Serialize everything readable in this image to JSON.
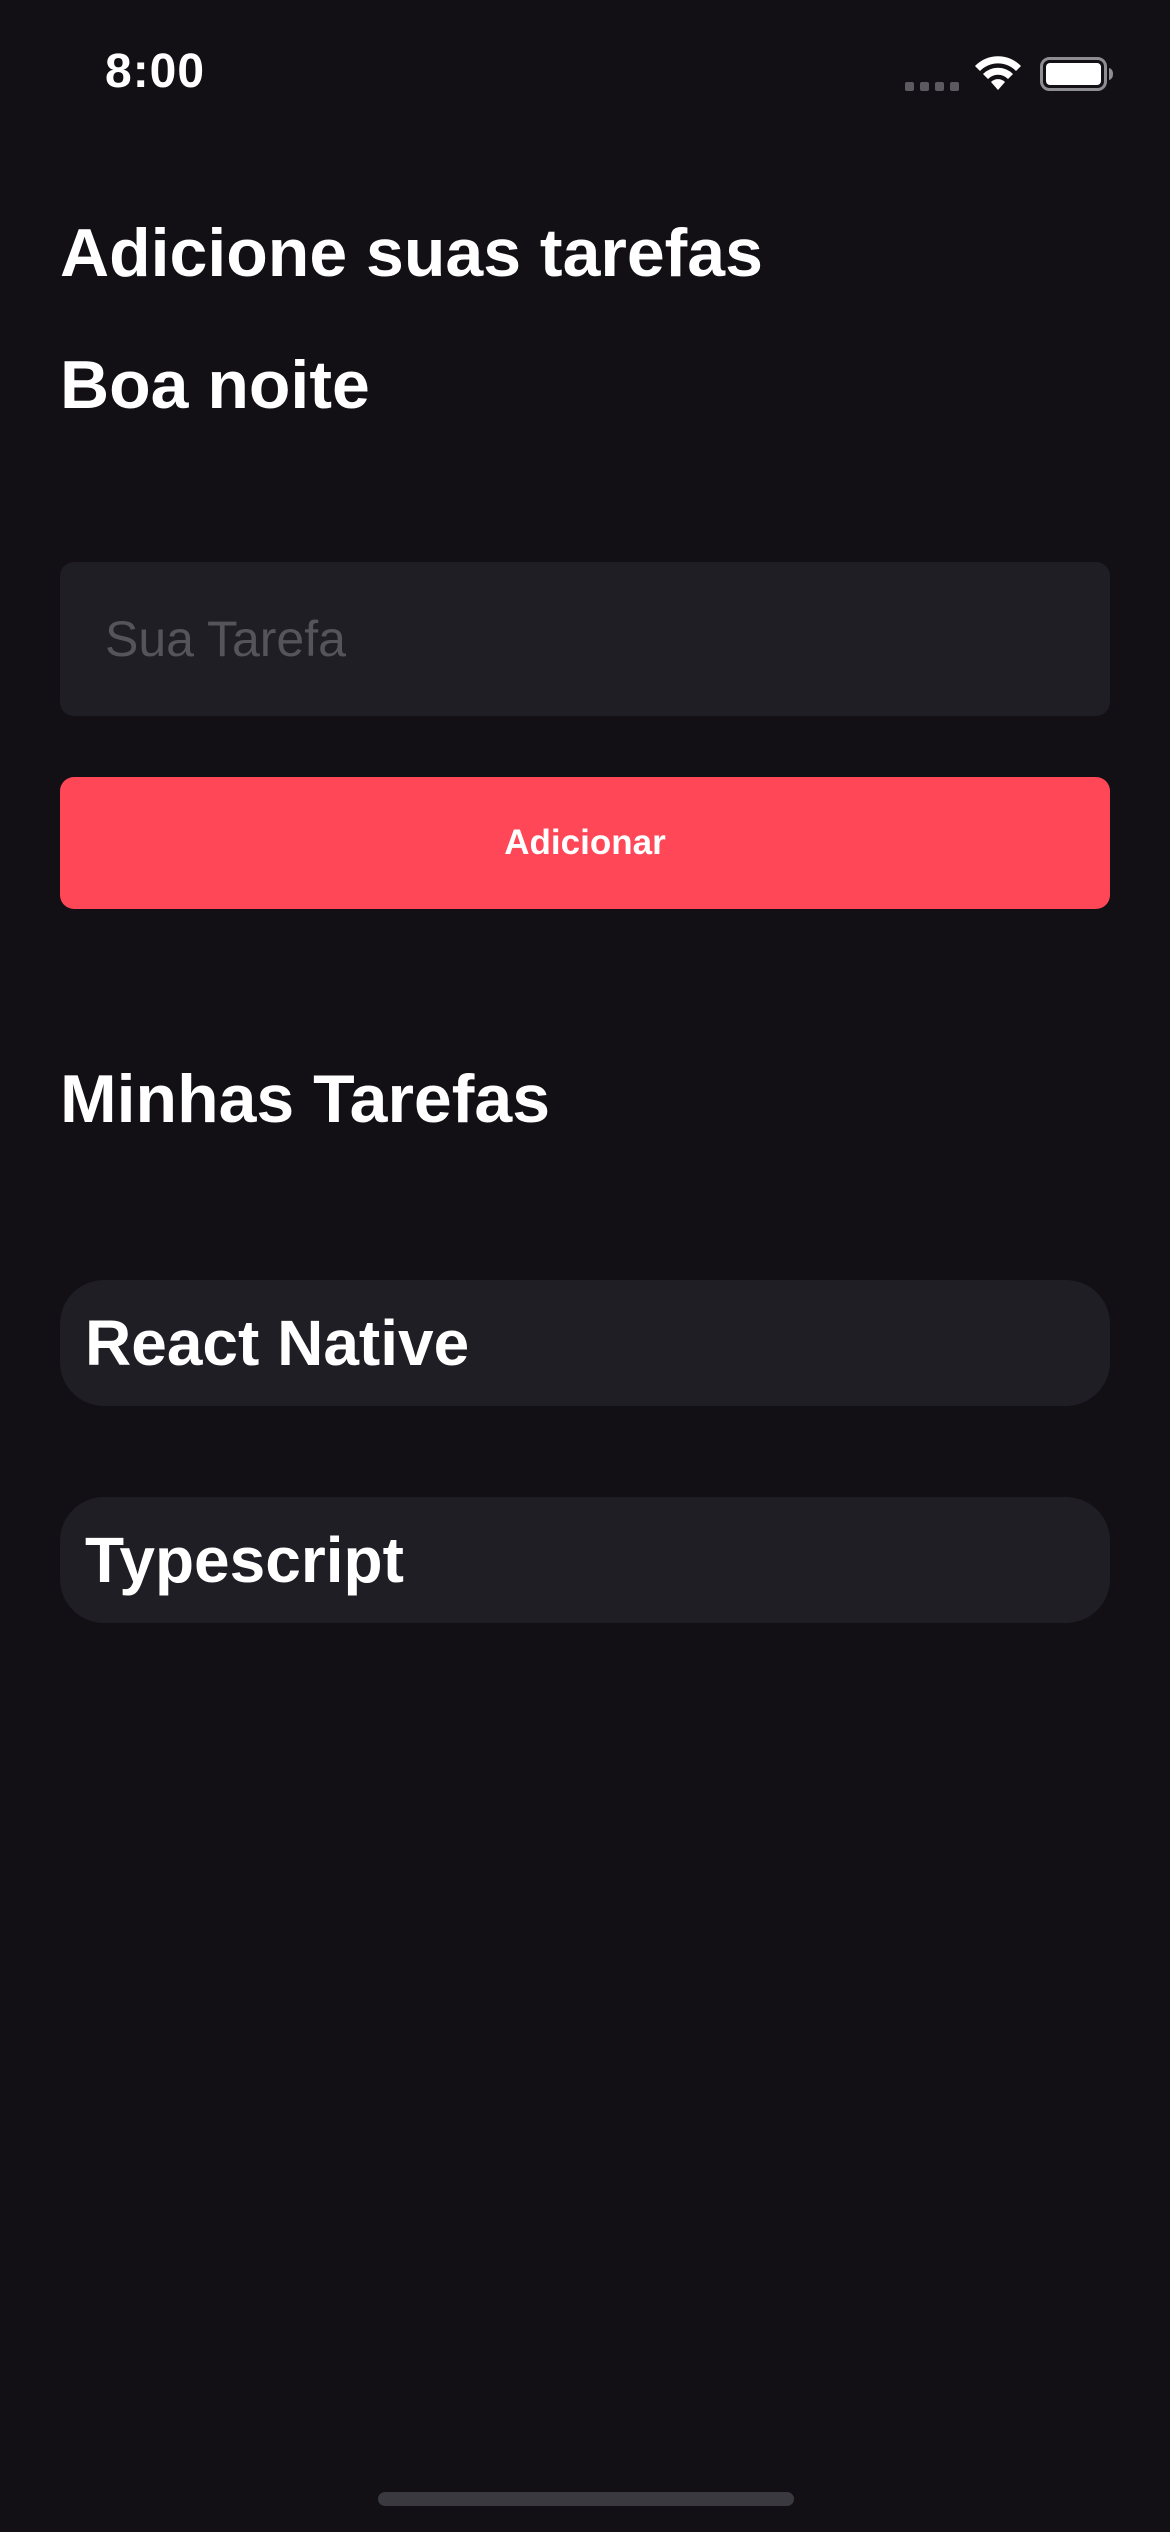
{
  "status_bar": {
    "time": "8:00",
    "icons": [
      "signal-dots-icon",
      "wifi-icon",
      "battery-icon"
    ]
  },
  "header": {
    "title": "Adicione suas tarefas",
    "greeting": "Boa noite"
  },
  "form": {
    "input_placeholder": "Sua Tarefa",
    "input_value": "",
    "add_button_label": "Adicionar"
  },
  "tasks": {
    "section_title": "Minhas Tarefas",
    "items": [
      {
        "label": "React Native"
      },
      {
        "label": "Typescript"
      }
    ]
  },
  "colors": {
    "background": "#121015",
    "surface": "#1f1e25",
    "accent": "#ff4757",
    "placeholder": "#55545a",
    "text": "#ffffff"
  }
}
